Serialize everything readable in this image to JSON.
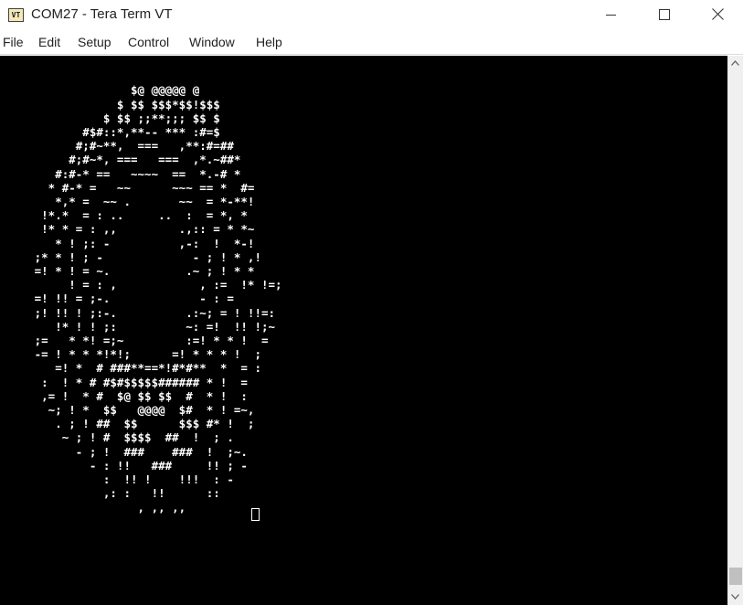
{
  "window": {
    "title": "COM27 - Tera Term VT",
    "icon_label": "VT",
    "icon": "teraterm-app-icon"
  },
  "window_controls": {
    "minimize_icon": "minimize-icon",
    "maximize_icon": "maximize-icon",
    "close_icon": "close-icon"
  },
  "menu": {
    "items": [
      "File",
      "Edit",
      "Setup",
      "Control",
      "Window",
      "Help"
    ]
  },
  "terminal": {
    "background": "#000000",
    "foreground": "#ffffff",
    "lines": [
      "",
      "",
      "                   $@ @@@@@ @",
      "                 $ $$ $$$*$$!$$$",
      "               $ $$ ;;**;;; $$ $",
      "            #$#::*,**-- *** :#=$",
      "           #;#~**,  ===   ,**:#=##",
      "          #;#~*, ===   ===  ,*.~##*",
      "        #:#-* ==   ~~~~  ==  *.-# *",
      "       * #-* =   ~~      ~~~ == *  #=",
      "        *,* =  ~~ .       ~~  = *-**!",
      "      !*.*  = : ..     ..  :  = *, *",
      "      !* * = : ,,         .,:: = * *~",
      "        * ! ;: -          ,-:  !  *-!",
      "     ;* * ! ; -             - ; ! * ,!",
      "     =! * ! = ~.           .~ ; ! * *",
      "          ! = : ,            , :=  !* !=;",
      "     =! !! = ;-.             - : =",
      "     ;! !! ! ;:-.          .:~; = ! !!=:",
      "        !* ! ! ;:          ~: =!  !! !;~",
      "     ;=   * *! =;~         :=! * * !  =",
      "     -= ! * * *!*!;      =! * * * !  ;",
      "        =! *  # ###**==*!#*#**  *  = :",
      "      :  ! * # #$#$$$$$###### * !  =",
      "      ,= !  * #  $@ $$ $$  #  * !  :",
      "       ~; ! *  $$   @@@@  $#  * ! =~,",
      "        . ; ! ##  $$      $$$ #* !  ;",
      "         ~ ; ! #  $$$$  ##  !  ; .",
      "           - ; !  ###    ###  !  ;~.",
      "             - : !!   ###     !! ; -",
      "               :  !! !    !!!  : -",
      "               ,: :   !!      ::",
      "                    , ,, ,,"
    ]
  },
  "scrollbar": {
    "up_icon": "scroll-up-arrow-icon",
    "down_icon": "scroll-down-arrow-icon"
  }
}
